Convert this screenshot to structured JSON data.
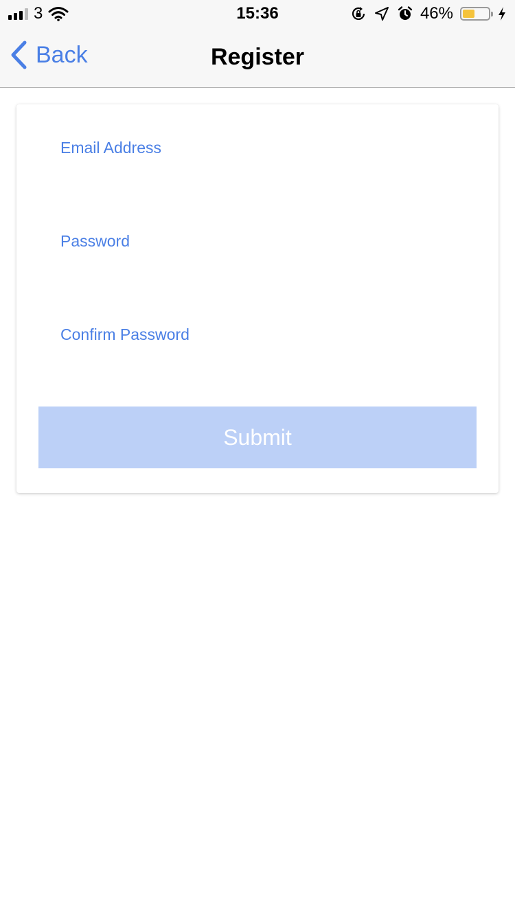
{
  "status_bar": {
    "carrier": "3",
    "time": "15:36",
    "battery_percent": "46%",
    "battery_level": 0.46,
    "icons": [
      "signal-icon",
      "wifi-icon",
      "rotation-lock-icon",
      "location-arrow-icon",
      "alarm-icon",
      "battery-icon",
      "charging-bolt-icon"
    ],
    "colors": {
      "battery_fill": "#f5c33b"
    }
  },
  "navbar": {
    "back_label": "Back",
    "title": "Register"
  },
  "form": {
    "email_label": "Email Address",
    "email_value": "",
    "password_label": "Password",
    "password_value": "",
    "confirm_label": "Confirm Password",
    "confirm_value": "",
    "submit_label": "Submit"
  },
  "colors": {
    "accent": "#4a7fe5",
    "submit_background": "#bcd0f7",
    "navbar_background": "#f7f7f7"
  }
}
